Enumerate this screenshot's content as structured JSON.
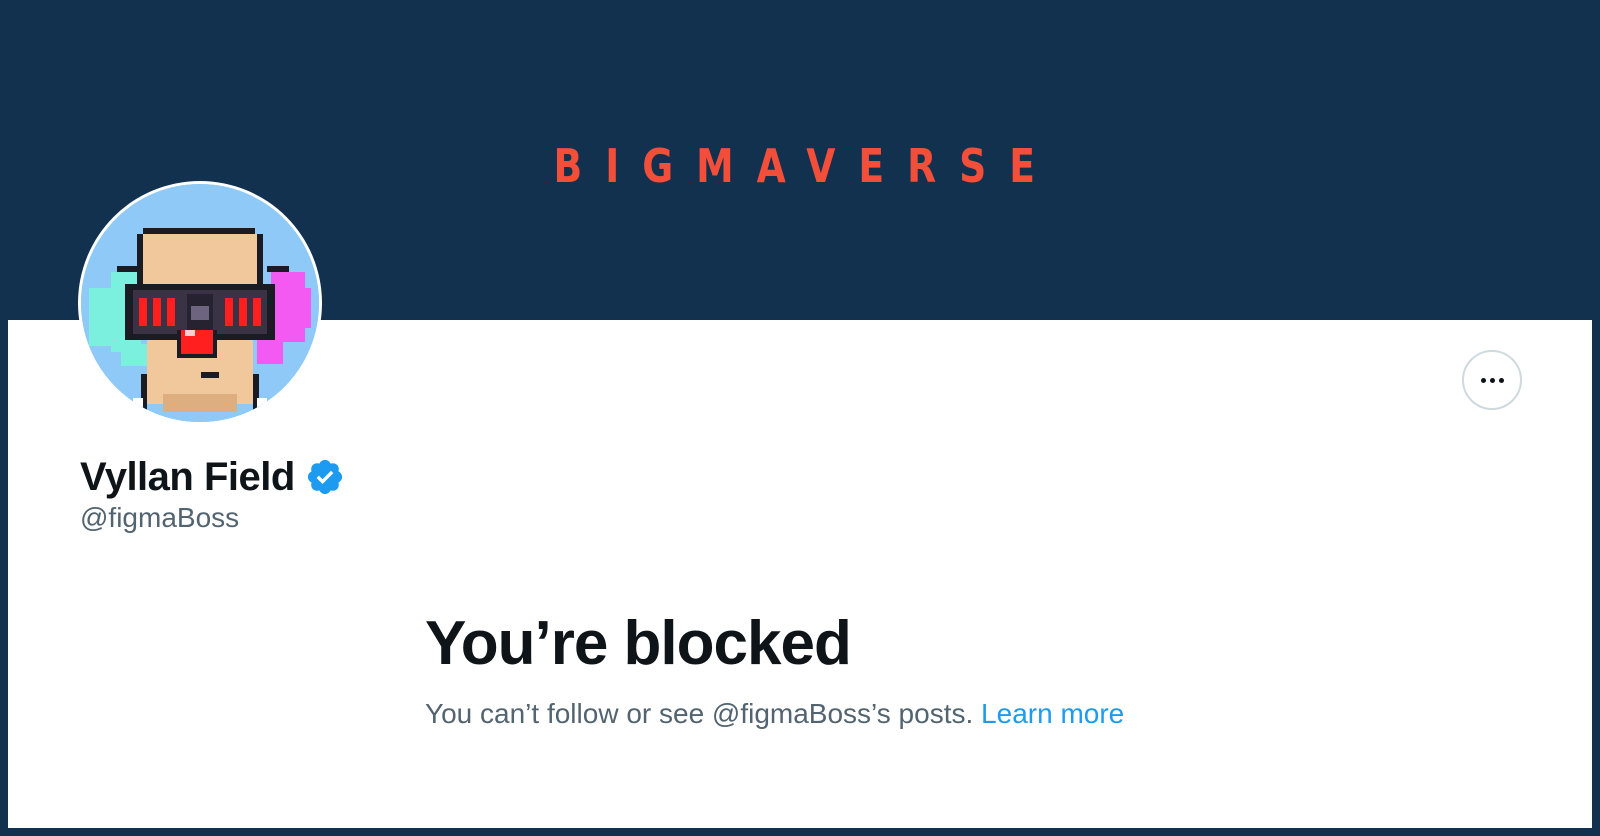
{
  "banner": {
    "title": "BIGMAVERSE",
    "background_color": "#12314f",
    "title_color": "#f24e3a"
  },
  "profile": {
    "display_name": "Vyllan Field",
    "verified": true,
    "verified_icon": "verified-badge-icon",
    "handle": "@figmaBoss",
    "avatar_icon": "pixel-art-avatar"
  },
  "actions": {
    "more_icon": "more-dots-icon"
  },
  "blocked_notice": {
    "title": "You’re blocked",
    "message": "You can’t follow or see @figmaBoss’s posts. ",
    "link_label": "Learn more",
    "link_color": "#1d9bf0"
  }
}
